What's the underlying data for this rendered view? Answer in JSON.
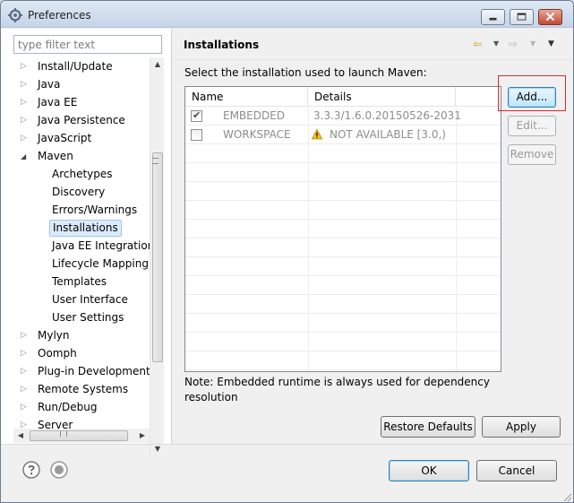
{
  "window": {
    "title": "Preferences",
    "icon": "preferences-gear-icon"
  },
  "filter": {
    "placeholder": "type filter text"
  },
  "tree": {
    "items": [
      {
        "label": "Install/Update",
        "level": 0,
        "expanded": false
      },
      {
        "label": "Java",
        "level": 0,
        "expanded": false
      },
      {
        "label": "Java EE",
        "level": 0,
        "expanded": false
      },
      {
        "label": "Java Persistence",
        "level": 0,
        "expanded": false
      },
      {
        "label": "JavaScript",
        "level": 0,
        "expanded": false
      },
      {
        "label": "Maven",
        "level": 0,
        "expanded": true
      },
      {
        "label": "Archetypes",
        "level": 1
      },
      {
        "label": "Discovery",
        "level": 1
      },
      {
        "label": "Errors/Warnings",
        "level": 1
      },
      {
        "label": "Installations",
        "level": 1,
        "selected": true
      },
      {
        "label": "Java EE Integration",
        "level": 1
      },
      {
        "label": "Lifecycle Mapping",
        "level": 1
      },
      {
        "label": "Templates",
        "level": 1
      },
      {
        "label": "User Interface",
        "level": 1
      },
      {
        "label": "User Settings",
        "level": 1
      },
      {
        "label": "Mylyn",
        "level": 0,
        "expanded": false
      },
      {
        "label": "Oomph",
        "level": 0,
        "expanded": false
      },
      {
        "label": "Plug-in Development",
        "level": 0,
        "expanded": false
      },
      {
        "label": "Remote Systems",
        "level": 0,
        "expanded": false
      },
      {
        "label": "Run/Debug",
        "level": 0,
        "expanded": false
      },
      {
        "label": "Server",
        "level": 0,
        "expanded": false
      }
    ]
  },
  "page": {
    "title": "Installations",
    "instruction": "Select the installation used to launch Maven:",
    "table": {
      "columns": [
        "Name",
        "Details"
      ],
      "rows": [
        {
          "checked": true,
          "name": "EMBEDDED",
          "details": "3.3.3/1.6.0.20150526-2031",
          "warning": false
        },
        {
          "checked": false,
          "name": "WORKSPACE",
          "details": "NOT AVAILABLE [3.0,)",
          "warning": true
        }
      ]
    },
    "buttons": {
      "add": "Add...",
      "edit": "Edit...",
      "remove": "Remove"
    },
    "note": "Note: Embedded runtime is always used for dependency resolution",
    "restore_defaults": "Restore Defaults",
    "apply": "Apply"
  },
  "footer": {
    "ok": "OK",
    "cancel": "Cancel"
  },
  "colors": {
    "accent_border": "#3c7fb1",
    "selection": "#dcebfc",
    "highlight_box": "#e0242d",
    "warning": "#e6a817"
  }
}
